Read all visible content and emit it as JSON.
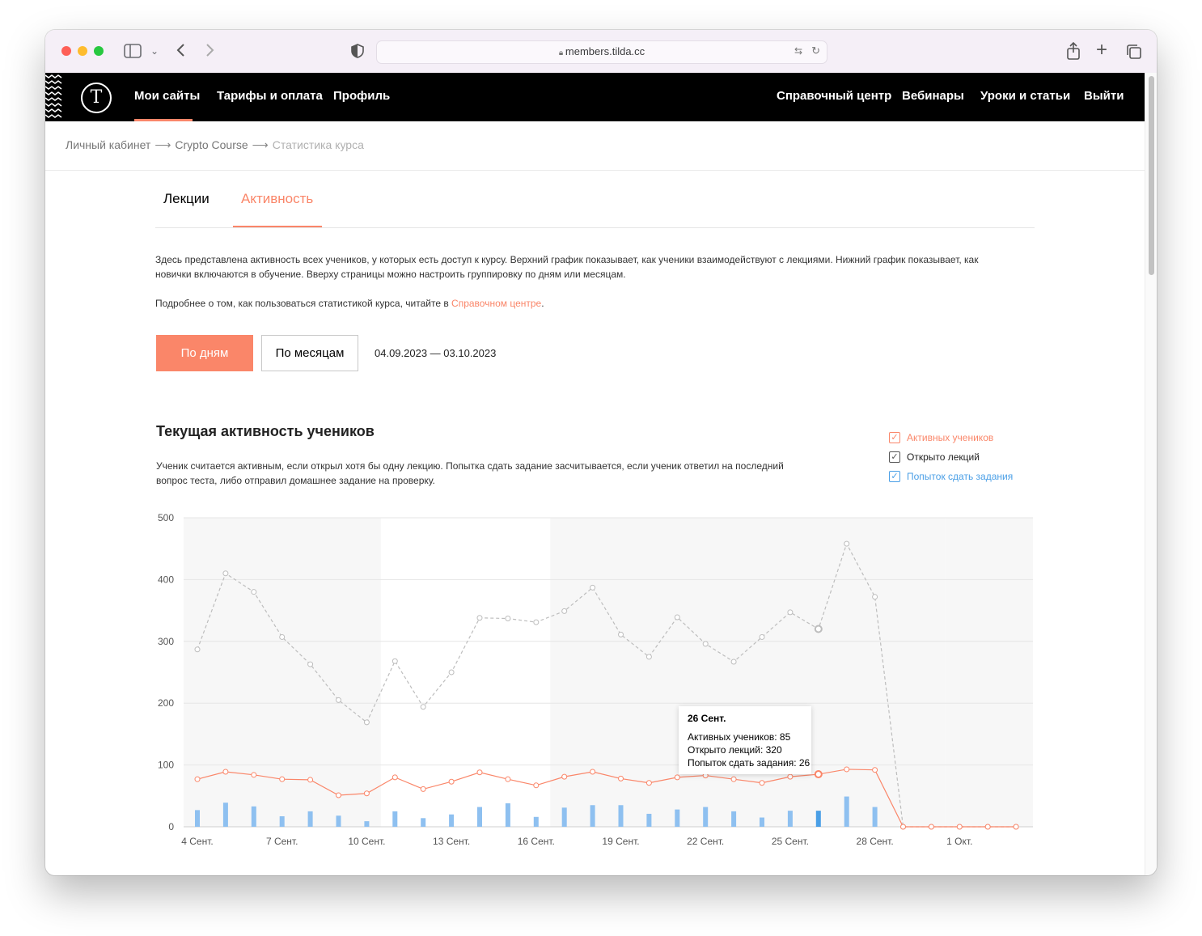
{
  "browser": {
    "url": "members.tilda.cc"
  },
  "nav": {
    "items_left": [
      "Мои сайты",
      "Тарифы и оплата",
      "Профиль"
    ],
    "items_right": [
      "Справочный центр",
      "Вебинары",
      "Уроки и статьи",
      "Выйти"
    ]
  },
  "breadcrumbs": [
    "Личный кабинет",
    "Crypto Course",
    "Статистика курса"
  ],
  "tabs": [
    "Лекции",
    "Активность"
  ],
  "intro": {
    "text": "Здесь представлена активность всех учеников, у которых есть доступ к курсу. Верхний график показывает, как ученики взаимодействуют с лекциями. Нижний график показывает, как новички включаются в обучение. Вверху страницы можно настроить группировку по дням или месяцам.",
    "help_prefix": "Подробнее о том, как пользоваться статистикой курса, читайте в ",
    "help_link": "Справочном центре",
    "help_suffix": "."
  },
  "controls": {
    "by_days": "По дням",
    "by_months": "По месяцам",
    "date_range": "04.09.2023 — 03.10.2023"
  },
  "section": {
    "title": "Текущая активность учеников",
    "note": "Ученик считается активным, если открыл хотя бы одну лекцию. Попытка сдать задание засчитывается, если ученик ответил на последний вопрос теста, либо отправил домашнее задание на проверку."
  },
  "legend": [
    {
      "label": "Активных учеников",
      "color": "#fa8669",
      "checked": true
    },
    {
      "label": "Открыто лекций",
      "color": "#555555",
      "checked": true
    },
    {
      "label": "Попыток сдать задания",
      "color": "#4a9fe6",
      "checked": true
    }
  ],
  "tooltip": {
    "title": "26 Сент.",
    "lines": [
      "Активных учеников: 85",
      "Открыто лекций: 320",
      "Попыток сдать задания: 26"
    ]
  },
  "chart_data": {
    "type": "line",
    "ylim": [
      0,
      500
    ],
    "yticks": [
      "0",
      "100",
      "200",
      "300",
      "400",
      "500"
    ],
    "xticks": [
      {
        "index": 0,
        "label": "4 Сент."
      },
      {
        "index": 3,
        "label": "7 Сент."
      },
      {
        "index": 6,
        "label": "10 Сент."
      },
      {
        "index": 9,
        "label": "13 Сент."
      },
      {
        "index": 12,
        "label": "16 Сент."
      },
      {
        "index": 15,
        "label": "19 Сент."
      },
      {
        "index": 18,
        "label": "22 Сент."
      },
      {
        "index": 21,
        "label": "25 Сент."
      },
      {
        "index": 24,
        "label": "28 Сент."
      },
      {
        "index": 27,
        "label": "1 Окт."
      }
    ],
    "grid": true,
    "weekend_shading": true,
    "highlight_index": 22,
    "series": [
      {
        "name": "Открыто лекций",
        "kind": "line-dashed",
        "color": "#bdbdbd",
        "values": [
          287,
          410,
          380,
          307,
          263,
          205,
          169,
          268,
          194,
          250,
          338,
          337,
          331,
          349,
          387,
          311,
          275,
          339,
          296,
          267,
          307,
          347,
          320,
          458,
          372,
          0,
          0,
          0,
          0,
          0
        ]
      },
      {
        "name": "Активных учеников",
        "kind": "line",
        "color": "#fa8669",
        "values": [
          77,
          89,
          84,
          77,
          76,
          51,
          54,
          80,
          61,
          73,
          88,
          77,
          67,
          81,
          89,
          78,
          71,
          80,
          83,
          77,
          71,
          81,
          85,
          93,
          92,
          0,
          0,
          0,
          0,
          0
        ]
      },
      {
        "name": "Попыток сдать задания",
        "kind": "bar",
        "color": "#8ec0f0",
        "values": [
          27,
          39,
          33,
          17,
          25,
          18,
          9,
          25,
          14,
          20,
          32,
          38,
          16,
          31,
          35,
          35,
          21,
          28,
          32,
          25,
          15,
          26,
          26,
          49,
          32,
          0,
          0,
          0,
          0,
          0
        ]
      }
    ]
  }
}
